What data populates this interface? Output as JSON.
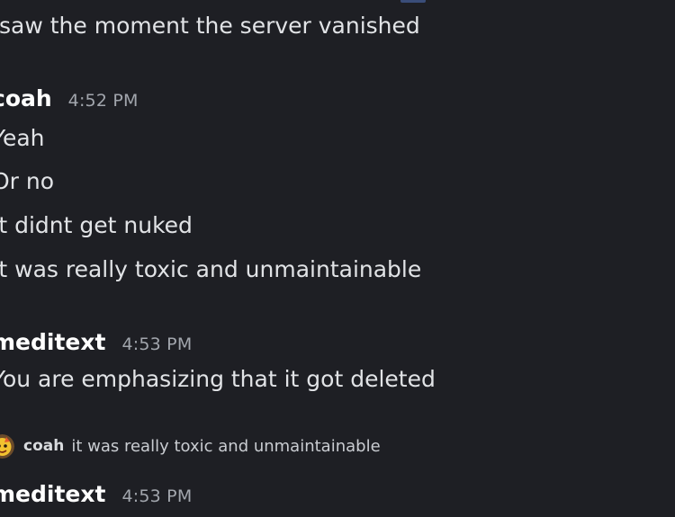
{
  "messages": {
    "prior_line": "saw the moment the server vanished",
    "group1": {
      "username": "coah",
      "time": "4:52 PM",
      "lines": [
        "Yeah",
        "Or no",
        "It didnt get nuked",
        "It was really toxic and unmaintainable"
      ]
    },
    "group2": {
      "username": "meditext",
      "time": "4:53 PM",
      "lines": [
        "You are emphasizing that it got deleted"
      ]
    },
    "reply_preview": {
      "username": "coah",
      "text": "it was really toxic and unmaintainable",
      "avatar_icon": "emoji-avatar-icon"
    },
    "group3": {
      "username": "meditext",
      "time": "4:53 PM"
    }
  },
  "colors": {
    "background": "#1e1f24",
    "text": "#e1e3e6",
    "username": "#ffffff",
    "timestamp": "#a2a6ad"
  }
}
